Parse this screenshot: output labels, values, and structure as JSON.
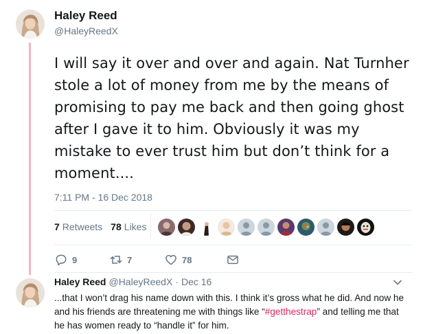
{
  "tweet": {
    "author": {
      "display_name": "Haley Reed",
      "handle": "@HaleyReedX"
    },
    "text": "I will say it over and over and again. Nat Turnher stole a lot of money from me by the means of promising to pay me back and then going ghost after I gave it to him. Obviously it was my mistake to ever trust him but don’t think for a moment....",
    "timestamp": "7:11 PM - 16 Dec 2018",
    "stats": {
      "retweets_count": "7",
      "retweets_label": "Retweets",
      "likes_count": "78",
      "likes_label": "Likes"
    },
    "actions": {
      "reply_count": "9",
      "retweet_count": "7",
      "like_count": "78"
    },
    "icons": [
      "reply-icon",
      "retweet-icon",
      "heart-icon",
      "message-icon"
    ],
    "colors": {
      "thread_line": "#f4b3c3",
      "secondary_text": "#657786",
      "hashtag": "#e0245e"
    }
  },
  "reply": {
    "display_name": "Haley Reed",
    "handle": "@HaleyReedX",
    "separator": "·",
    "date": "Dec 16",
    "text_before": "...that I won’t drag his name down with this. I think it’s gross what he did. And now he and his friends are threatening me with things like “",
    "hashtag": "#getthestrap",
    "text_after": "” and telling me that he has women ready to “handle it” for him."
  }
}
